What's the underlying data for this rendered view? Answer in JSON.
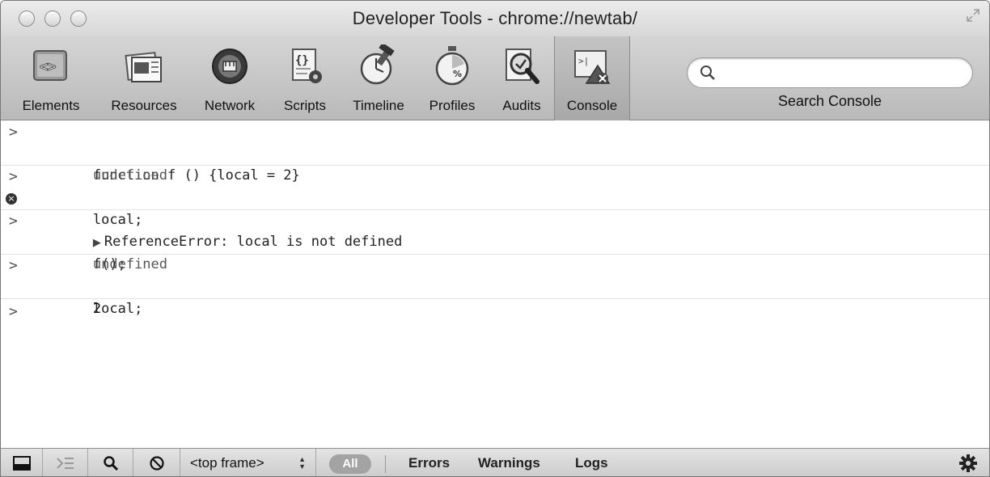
{
  "window": {
    "title": "Developer Tools - chrome://newtab/"
  },
  "toolbar": {
    "tabs": [
      {
        "label": "Elements",
        "icon": "elements-icon"
      },
      {
        "label": "Resources",
        "icon": "resources-icon"
      },
      {
        "label": "Network",
        "icon": "network-icon"
      },
      {
        "label": "Scripts",
        "icon": "scripts-icon"
      },
      {
        "label": "Timeline",
        "icon": "timeline-icon"
      },
      {
        "label": "Profiles",
        "icon": "profiles-icon"
      },
      {
        "label": "Audits",
        "icon": "audits-icon"
      },
      {
        "label": "Console",
        "icon": "console-icon",
        "active": true
      }
    ],
    "search": {
      "value": "",
      "label": "Search Console"
    }
  },
  "console": {
    "entries": [
      {
        "command": "function f () {local = 2}",
        "result": "undefined"
      },
      {
        "command": "local;",
        "error": "ReferenceError: local is not defined"
      },
      {
        "command": "f();",
        "result": "undefined"
      },
      {
        "command": "local;",
        "result": "2"
      }
    ],
    "prompt_symbol": ">"
  },
  "statusbar": {
    "frame_selector": "<top frame>",
    "filter_all": "All",
    "filters": [
      "Errors",
      "Warnings",
      "Logs"
    ]
  },
  "colors": {
    "toolbar": "#c8c8c8",
    "error_icon": "#333333"
  }
}
